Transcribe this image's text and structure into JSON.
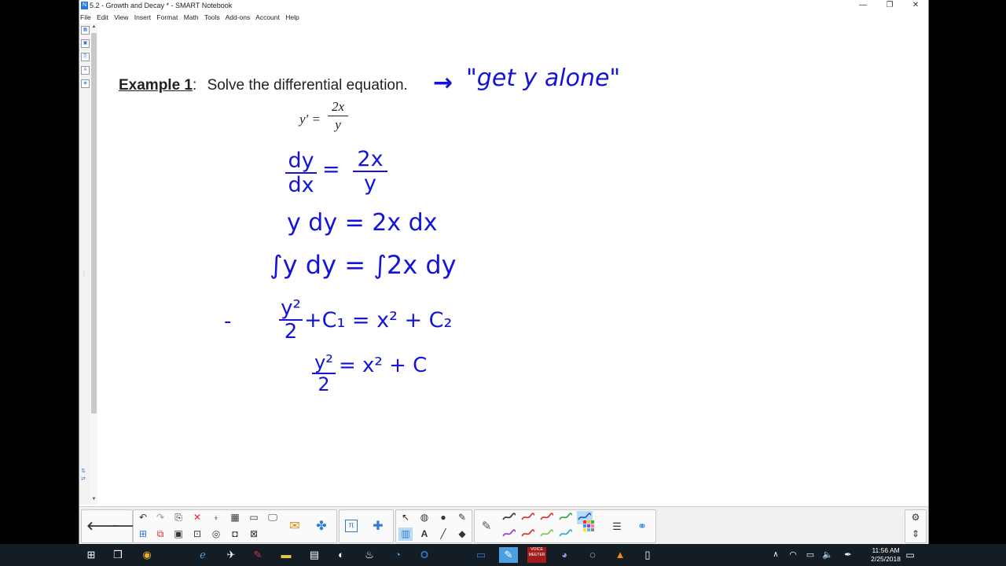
{
  "window": {
    "title": "5.2 - Growth and Decay * - SMART Notebook",
    "app_icon": "notebook-app-icon",
    "controls": {
      "minimize": "—",
      "restore": "❐",
      "close": "✕"
    }
  },
  "menu": [
    "File",
    "Edit",
    "View",
    "Insert",
    "Format",
    "Math",
    "Tools",
    "Add-ons",
    "Account",
    "Help"
  ],
  "page": {
    "example_label": "Example 1",
    "example_colon": ":",
    "problem": "Solve the differential equation.",
    "equation": {
      "lhs": "y′ =",
      "num": "2x",
      "den": "y"
    },
    "annotation_arrow": "→",
    "annotation": "\"get y alone\"",
    "steps": {
      "s1_num_l": "dy",
      "s1_den_l": "dx",
      "s1_eq": "=",
      "s1_num_r": "2x",
      "s1_den_r": "y",
      "s2": "y dy = 2x dx",
      "s3": "∫y dy = ∫2x dy",
      "s4_num": "y²",
      "s4_den": "2",
      "s4_rest": "+C₁ = x² + C₂",
      "s5_num": "y²",
      "s5_den": "2",
      "s5_rest": "= x² + C",
      "margin_mark": "-"
    }
  },
  "toolbar": {
    "nav": {
      "back": "🡐",
      "forward": "🡒"
    },
    "edit_icons": [
      "undo-icon",
      "redo-icon",
      "paste-icon",
      "delete-icon",
      "screen-shade-icon",
      "table-icon",
      "full-screen-icon",
      "display-icon",
      "add-page-icon",
      "screen-capture-icon",
      "save-icon",
      "document-camera-icon",
      "web-browser-icon",
      "camera-icon",
      "capture-icon"
    ],
    "addon_icons": [
      "activity-builder-icon",
      "lab-icon",
      "math-tools-icon",
      "response-icon"
    ],
    "tool_icons": [
      "select-icon",
      "shapes-icon",
      "fill-icon",
      "magic-pen-icon",
      "table-tool-icon",
      "text-icon",
      "line-icon",
      "eraser-icon"
    ],
    "pen_colors_top": [
      "#333333",
      "#d62a2a",
      "#d62a2a",
      "#2aa844",
      "#1a4fd6"
    ],
    "pen_colors_bottom": [
      "#9b34c9",
      "#d62a2a",
      "#7fc241",
      "#2aa8c9"
    ],
    "right_icons": [
      "settings-icon",
      "toolbar-position-icon"
    ]
  },
  "taskbar": {
    "apps": [
      "start-icon",
      "task-view-icon",
      "chrome-icon",
      "edge-icon",
      "bird-icon",
      "app-icon",
      "folder-icon",
      "file-explorer-icon",
      "obs-icon",
      "steam-icon",
      "outlook-icon",
      "calendar-icon",
      "smart-notebook-icon",
      "voicemeeter-icon",
      "discord-icon",
      "game-icon",
      "vlc-icon",
      "notepad-icon"
    ],
    "voicemeeter_label": "VOICE\nMEETER",
    "time": "11:56 AM",
    "date": "2/25/2018",
    "tray_icons": [
      "tray-chevron-icon",
      "network-icon",
      "volume-icon",
      "pen-icon",
      "keyboard-icon",
      "notification-icon"
    ]
  }
}
